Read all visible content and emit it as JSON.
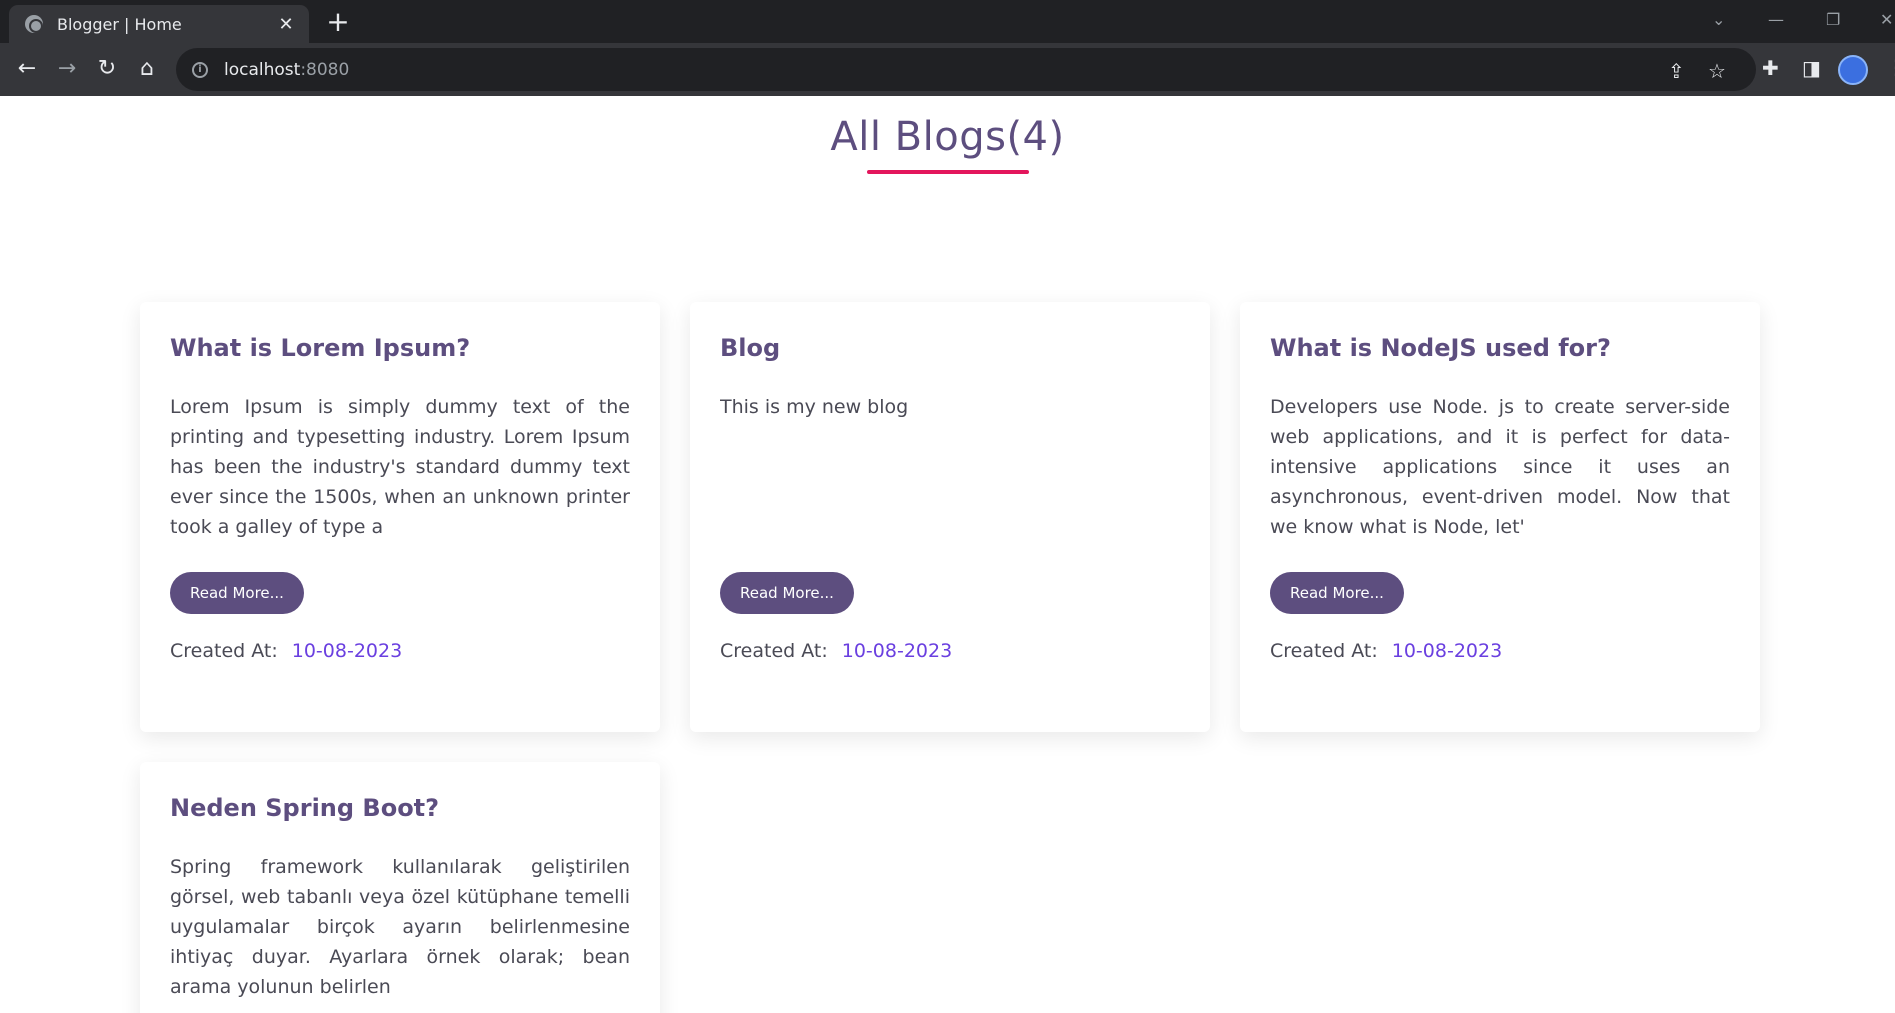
{
  "browser": {
    "tab_title": "Blogger | Home",
    "url_host": "localhost",
    "url_port": ":8080"
  },
  "page": {
    "heading": "All Blogs(4)",
    "created_label": "Created At:",
    "read_more_label": "Read More..."
  },
  "blogs": [
    {
      "title": "What is Lorem Ipsum?",
      "excerpt": "Lorem Ipsum is simply dummy text of the printing and typesetting industry. Lorem Ipsum has been the industry's standard dummy text ever since the 1500s, when an unknown printer took a galley of type a",
      "created_at": "10-08-2023"
    },
    {
      "title": "Blog",
      "excerpt": "This is my new blog",
      "created_at": "10-08-2023"
    },
    {
      "title": "What is NodeJS used for?",
      "excerpt": "Developers use Node. js to create server-side web applications, and it is perfect for data-intensive applications since it uses an asynchronous, event-driven model. Now that we know what is Node, let'",
      "created_at": "10-08-2023"
    },
    {
      "title": "Neden Spring Boot?",
      "excerpt": "Spring framework kullanılarak geliştirilen görsel, web tabanlı veya özel kütüphane temelli uygulamalar birçok ayarın belirlenmesine ihtiyaç duyar. Ayarlara örnek olarak; bean arama yolunun belirlen",
      "created_at": ""
    }
  ],
  "colors": {
    "accent": "#5d4e7f",
    "underline": "#e3165c",
    "date": "#6a3fe0"
  }
}
